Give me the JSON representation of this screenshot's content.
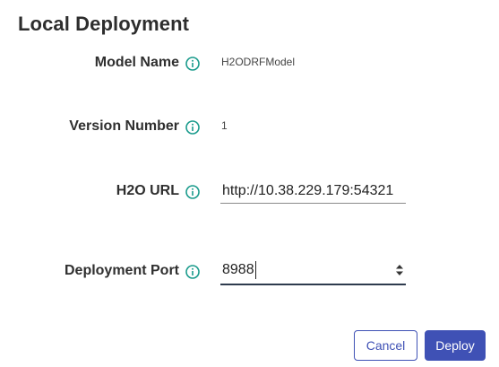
{
  "dialog": {
    "title": "Local Deployment"
  },
  "fields": {
    "model_name": {
      "label": "Model Name",
      "value": "H2ODRFModel"
    },
    "version_number": {
      "label": "Version Number",
      "value": "1"
    },
    "h2o_url": {
      "label": "H2O URL",
      "value": "http://10.38.229.179:54321"
    },
    "deployment_port": {
      "label": "Deployment Port",
      "value": "8988"
    }
  },
  "buttons": {
    "cancel_label": "Cancel",
    "deploy_label": "Deploy"
  },
  "colors": {
    "accent": "#3f51b5",
    "info_icon": "#1a9b8c"
  },
  "icons": {
    "info": "info-icon",
    "spinner": "spinner-arrows-icon"
  }
}
